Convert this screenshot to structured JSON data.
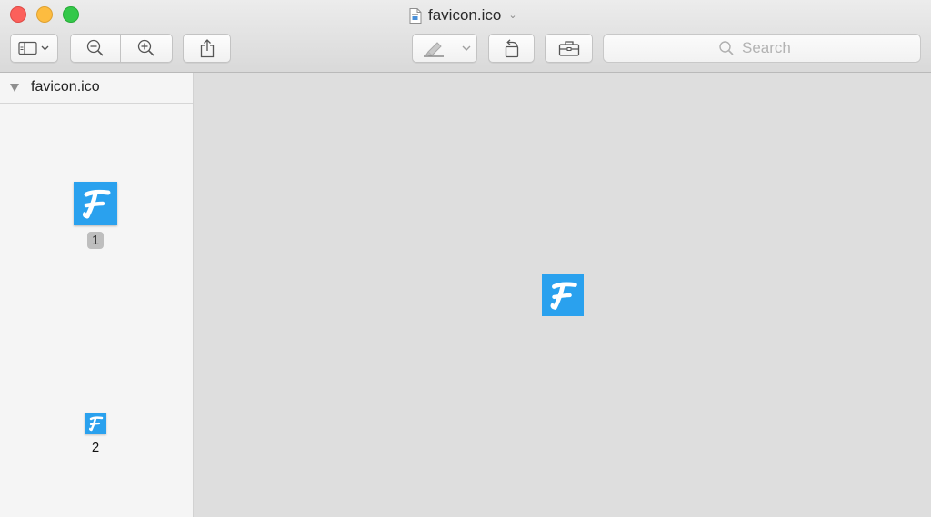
{
  "window": {
    "title": "favicon.ico",
    "title_chevron": "⌄",
    "traffic_lights": {
      "close_color": "#fc605b",
      "minimize_color": "#fdbc40",
      "zoom_color": "#34c84a"
    }
  },
  "toolbar": {
    "sidebar_toggle_icon": "sidebar-icon",
    "zoom_out_icon": "zoom-out-icon",
    "zoom_in_icon": "zoom-in-icon",
    "share_icon": "share-icon",
    "markup_icon": "highlighter-icon",
    "rotate_icon": "rotate-left-icon",
    "toolbox_icon": "toolbox-icon"
  },
  "search": {
    "placeholder": "Search",
    "value": ""
  },
  "sidebar": {
    "file_name": "favicon.ico",
    "pages": [
      {
        "label": "1",
        "selected": true
      },
      {
        "label": "2",
        "selected": false
      }
    ]
  },
  "colors": {
    "favicon_background": "#2aa1ee",
    "favicon_letter": "#ffffff"
  },
  "content": {
    "image_letter": "F"
  }
}
